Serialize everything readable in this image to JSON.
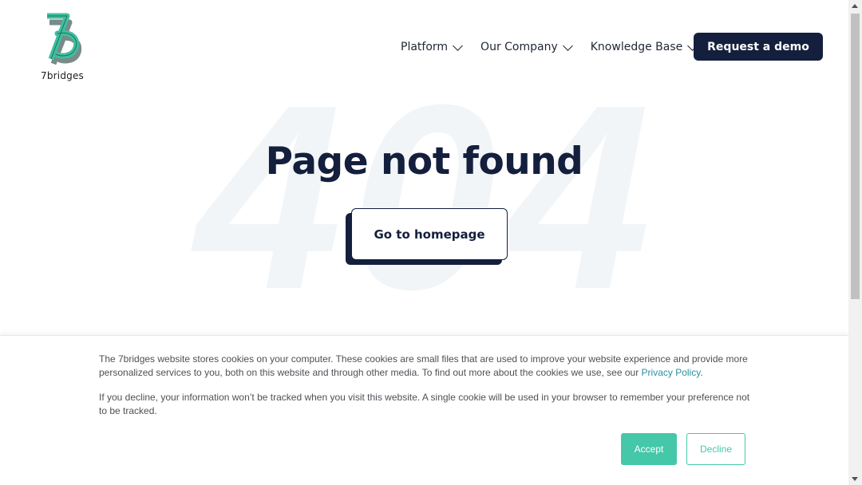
{
  "brand": {
    "logo_text": "7bridges",
    "logo_icon": "7b-logo-icon"
  },
  "nav": {
    "items": [
      {
        "label": "Platform",
        "icon": "chevron-down-icon"
      },
      {
        "label": "Our Company",
        "icon": "chevron-down-icon"
      },
      {
        "label": "Knowledge Base",
        "icon": "chevron-down-icon"
      }
    ],
    "demo_label": "Request a demo"
  },
  "hero": {
    "bg_code": "404",
    "title": "Page not found",
    "home_button": "Go to homepage"
  },
  "cookie": {
    "p1_text": "The 7bridges website stores cookies on your computer. These cookies are small files that are used to improve your website experience and provide more personalized services to you, both on this website and through other media. To find out more about the cookies we use, see our ",
    "privacy_link": "Privacy Policy",
    "p1_end": ".",
    "p2_text": "If you decline, your information won’t be tracked when you visit this website. A single cookie will be used in your browser to remember your preference not to be tracked.",
    "accept_label": "Accept",
    "decline_label": "Decline"
  },
  "colors": {
    "navy": "#141f3d",
    "teal": "#45c7a9",
    "logo_teal": "#3fbf9f",
    "bg_404": "#f1f5f8",
    "link": "#2a8fa0"
  }
}
